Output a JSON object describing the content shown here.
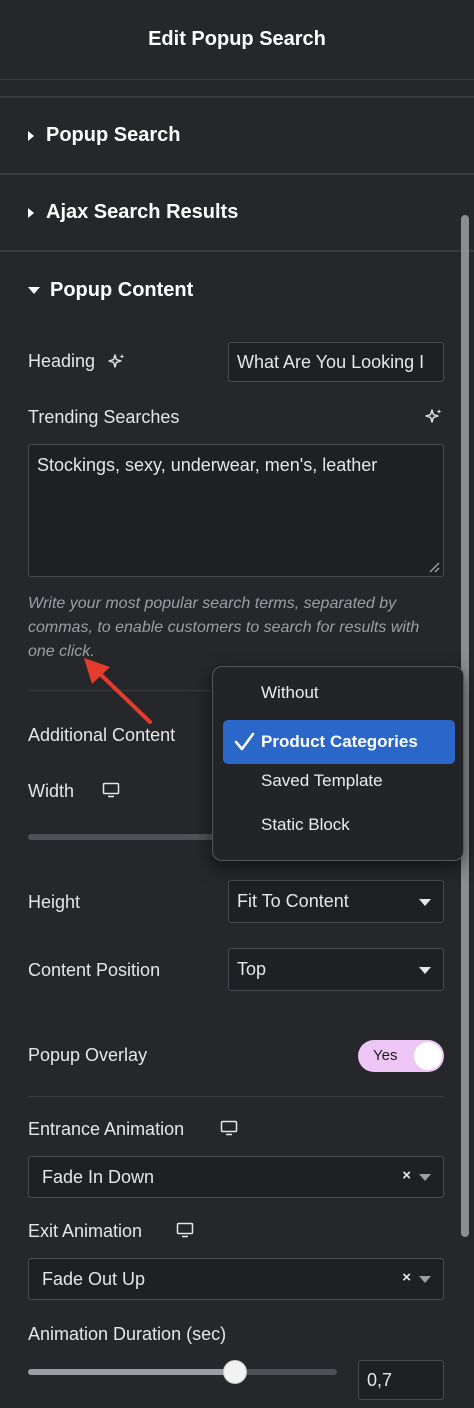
{
  "header": {
    "title": "Edit Popup Search"
  },
  "sections": {
    "popup_search": "Popup Search",
    "ajax_search_results": "Ajax Search Results",
    "popup_content": "Popup Content"
  },
  "popup_content": {
    "heading": {
      "label": "Heading",
      "value": "What Are You Looking I"
    },
    "trending": {
      "label": "Trending Searches",
      "value": "Stockings, sexy, underwear, men's, leather",
      "help": "Write your most popular search terms, separated by commas, to enable customers to search for results with one click."
    },
    "additional_content": {
      "label": "Additional Content",
      "options": [
        "Without",
        "Product Categories",
        "Saved Template",
        "Static Block"
      ],
      "selected": "Product Categories"
    },
    "width": {
      "label": "Width"
    },
    "height": {
      "label": "Height",
      "value": "Fit To Content"
    },
    "content_position": {
      "label": "Content Position",
      "value": "Top"
    },
    "popup_overlay": {
      "label": "Popup Overlay",
      "value": "Yes"
    },
    "entrance_animation": {
      "label": "Entrance Animation",
      "value": "Fade In Down",
      "clear": "×"
    },
    "exit_animation": {
      "label": "Exit Animation",
      "value": "Fade Out Up",
      "clear": "×"
    },
    "animation_duration": {
      "label": "Animation Duration (sec)",
      "value": "0,7",
      "level": 0.67
    }
  },
  "icons": {
    "sparkle": "sparkle-icon",
    "monitor": "monitor-icon",
    "check": "check-icon",
    "annotation_arrow": "red-arrow"
  },
  "colors": {
    "background": "#26272b",
    "selected_option": "#2b67c8",
    "toggle": "#eec6f5",
    "annotation": "#e53b2c"
  }
}
